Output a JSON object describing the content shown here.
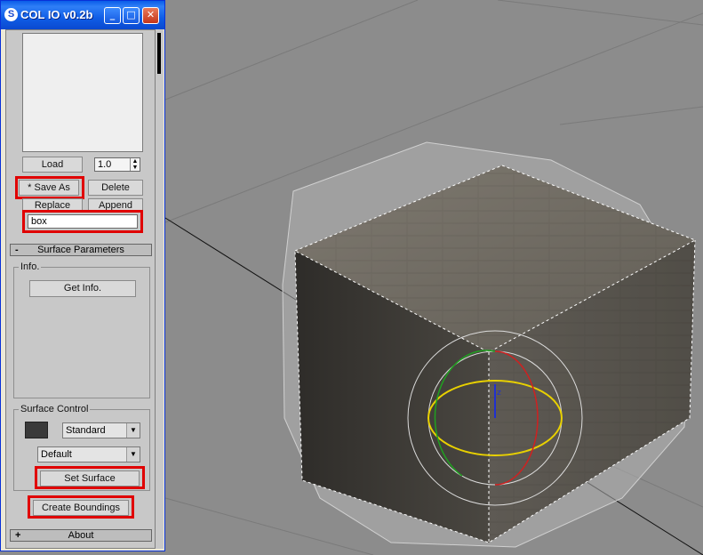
{
  "window": {
    "title": "COL IO v0.2b",
    "icon": "3ds-max-logo",
    "controls": {
      "minimize": "_",
      "maximize": "□",
      "close": "✕"
    }
  },
  "top_section": {
    "load_label": "Load",
    "version_value": "1.0",
    "save_as_label": "* Save As",
    "delete_label": "Delete",
    "replace_label": "Replace",
    "append_label": "Append",
    "name_value": "box"
  },
  "surface_parameters": {
    "rollout_sign": "-",
    "rollout_label": "Surface Parameters",
    "info_label": "Info.",
    "get_info_label": "Get Info.",
    "surface_control_label": "Surface Control",
    "color_swatch": "#3a3a3a",
    "material_select": "Standard",
    "part_select": "Default",
    "set_surface_label": "Set Surface",
    "create_boundings_label": "Create Boundings"
  },
  "about_rollout": {
    "sign": "+",
    "label": "About"
  },
  "viewport_gizmo": {
    "axis_label": "z"
  },
  "colors": {
    "highlight": "#e00000",
    "titlebar": "#0a5ce8",
    "viewport": "#8c8c8c"
  }
}
